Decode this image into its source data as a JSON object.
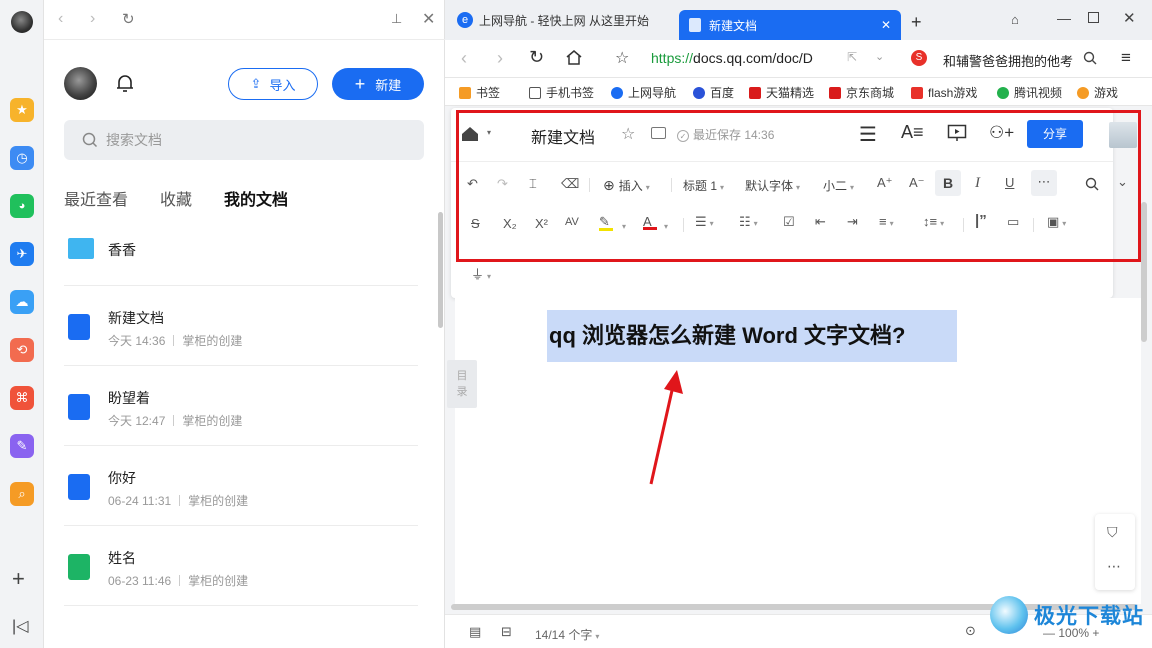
{
  "panel": {
    "import_label": "导入",
    "new_label": "新建",
    "search_placeholder": "搜索文档",
    "tabs": [
      "最近查看",
      "收藏",
      "我的文档"
    ],
    "folder_name": "香香",
    "docs": [
      {
        "name": "新建文档",
        "time": "今天 14:36",
        "creator": "掌柜的创建",
        "type": "doc"
      },
      {
        "name": "盼望着",
        "time": "今天 12:47",
        "creator": "掌柜的创建",
        "type": "doc"
      },
      {
        "name": "你好",
        "time": "06-24 11:31",
        "creator": "掌柜的创建",
        "type": "doc"
      },
      {
        "name": "姓名",
        "time": "06-23 11:46",
        "creator": "掌柜的创建",
        "type": "sheet"
      }
    ]
  },
  "browser": {
    "tabs": [
      {
        "title": "上网导航 - 轻快上网 从这里开始",
        "active": false
      },
      {
        "title": "新建文档",
        "active": true
      }
    ],
    "url_green": "https://",
    "url_rest": "docs.qq.com/doc/D",
    "search_text": "和辅警爸爸拥抱的他考",
    "bookmarks": [
      "书签",
      "手机书签",
      "上网导航",
      "百度",
      "天猫精选",
      "京东商城",
      "flash游戏",
      "腾讯视频",
      "游戏"
    ]
  },
  "editor": {
    "doc_title": "新建文档",
    "save_status": "最近保存 14:36",
    "share_label": "分享",
    "insert_label": "插入",
    "heading_label": "标题 1",
    "font_label": "默认字体",
    "size_label": "小二",
    "toc_label": "目录",
    "heading_text": "qq 浏览器怎么新建 Word 文字文档?",
    "word_count": "14/14 个字",
    "zoom": "100%"
  },
  "watermark": "极光下载站",
  "colors": {
    "accent": "#1a6cf2",
    "highlight": "#c9daf8",
    "annotation": "#e0161b"
  }
}
